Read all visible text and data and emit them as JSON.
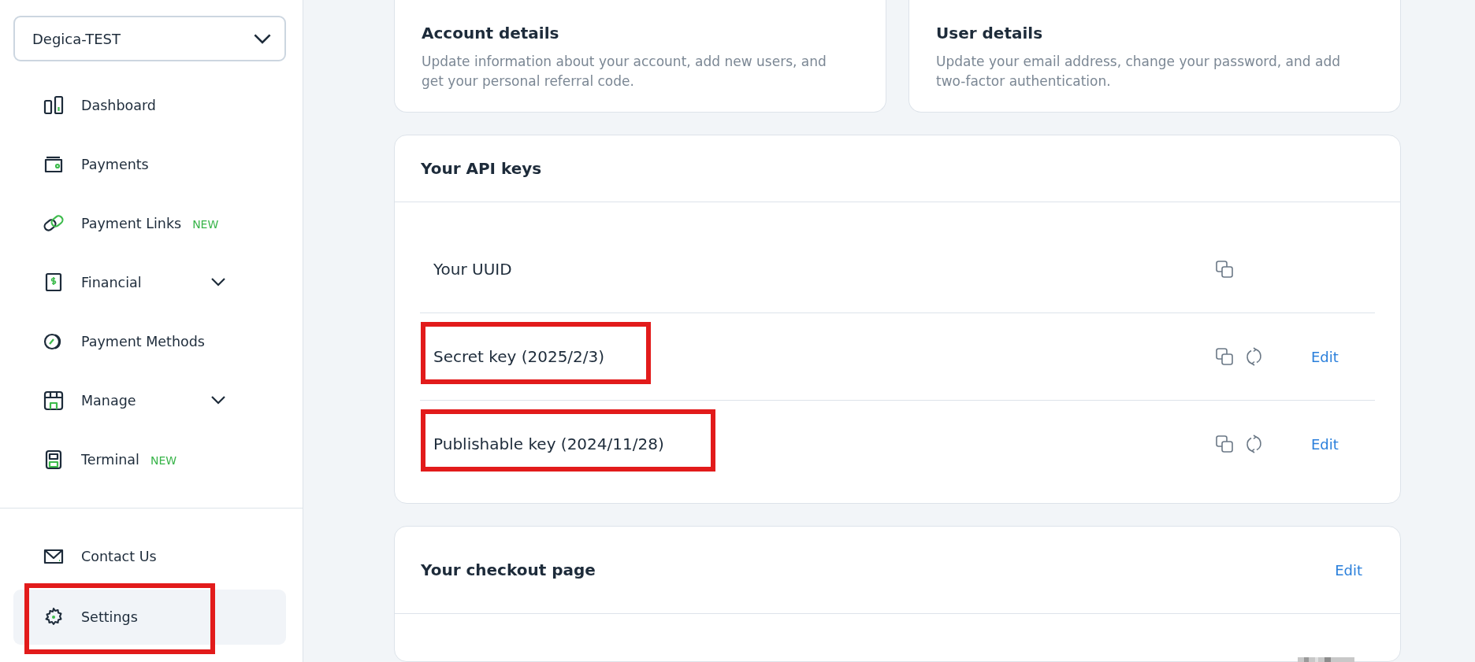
{
  "sidebar": {
    "account_selector": {
      "value": "Degica-TEST"
    },
    "items": [
      {
        "label": "Dashboard",
        "has_submenu": false,
        "selected": false,
        "highlighted": false
      },
      {
        "label": "Payments",
        "has_submenu": false,
        "selected": false,
        "highlighted": false
      },
      {
        "label": "Payment Links",
        "badge": "NEW",
        "has_submenu": false,
        "selected": false,
        "highlighted": false
      },
      {
        "label": "Financial",
        "has_submenu": true,
        "selected": false,
        "highlighted": false
      },
      {
        "label": "Payment Methods",
        "has_submenu": false,
        "selected": false,
        "highlighted": false
      },
      {
        "label": "Manage",
        "has_submenu": true,
        "selected": false,
        "highlighted": false
      },
      {
        "label": "Terminal",
        "badge": "NEW",
        "has_submenu": false,
        "selected": false,
        "highlighted": false
      }
    ],
    "bottom_items": [
      {
        "label": "Contact Us",
        "selected": false,
        "highlighted": false
      },
      {
        "label": "Settings",
        "selected": true,
        "highlighted": true
      }
    ]
  },
  "cards": [
    {
      "title": "Account details",
      "description": "Update information about your account, add new users, and get your personal referral code."
    },
    {
      "title": "User details",
      "description": "Update your email address, change your password, and add two-factor authentication."
    }
  ],
  "api_keys": {
    "title": "Your API keys",
    "rows": [
      {
        "label": "Your UUID",
        "regenerate": false,
        "highlighted": false
      },
      {
        "label": "Secret key (2025/2/3)",
        "regenerate": true,
        "edit": "Edit",
        "highlighted": true
      },
      {
        "label": "Publishable key (2024/11/28)",
        "regenerate": true,
        "edit": "Edit",
        "highlighted": true
      }
    ]
  },
  "checkout": {
    "title": "Your checkout page",
    "edit": "Edit"
  }
}
